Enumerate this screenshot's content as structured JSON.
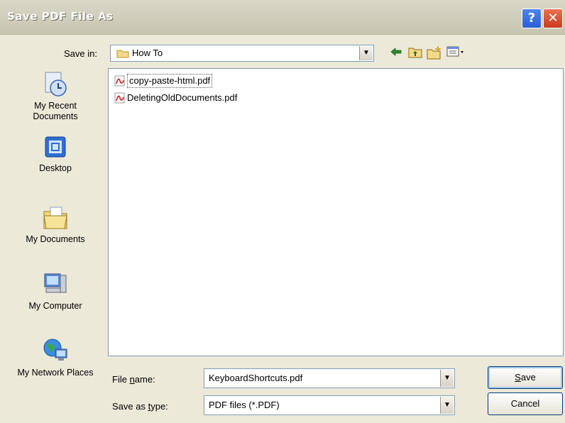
{
  "window": {
    "title": "Save PDF File As",
    "help_glyph": "?",
    "close_glyph": "✕"
  },
  "save_in": {
    "label": "Save in:",
    "value": "How To"
  },
  "places": [
    {
      "label": "My Recent Documents",
      "icon": "recent-documents-icon"
    },
    {
      "label": "Desktop",
      "icon": "desktop-icon"
    },
    {
      "label": "My Documents",
      "icon": "my-documents-icon"
    },
    {
      "label": "My Computer",
      "icon": "my-computer-icon"
    },
    {
      "label": "My Network Places",
      "icon": "network-places-icon"
    }
  ],
  "files": [
    {
      "name": "copy-paste-html.pdf",
      "selected": true
    },
    {
      "name": "DeletingOldDocuments.pdf",
      "selected": false
    }
  ],
  "file_name": {
    "label_pre": "File ",
    "label_ul": "n",
    "label_post": "ame:",
    "value": "KeyboardShortcuts.pdf"
  },
  "save_as_type": {
    "label_pre": "Save as ",
    "label_ul": "t",
    "label_post": "ype:",
    "value": "PDF files (*.PDF)"
  },
  "buttons": {
    "save_ul": "S",
    "save_rest": "ave",
    "cancel": "Cancel"
  },
  "colors": {
    "dialog_bg": "#ece9d8",
    "border_blue": "#7f9db9",
    "help_blue": "#2a5fd3",
    "close_red": "#c8391d"
  }
}
